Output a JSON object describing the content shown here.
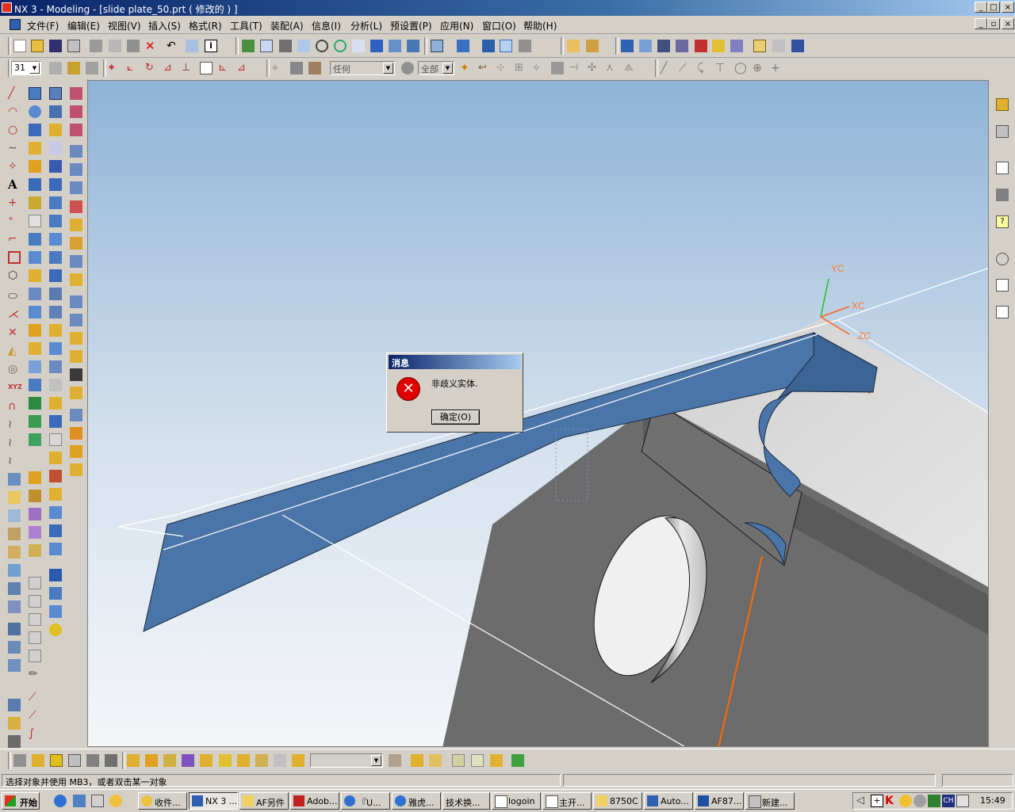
{
  "window": {
    "title": "NX 3 - Modeling - [slide plate_50.prt ( 修改的 ) ]",
    "controls": [
      "_",
      "□",
      "×"
    ]
  },
  "menu": {
    "items": [
      "文件(F)",
      "编辑(E)",
      "视图(V)",
      "插入(S)",
      "格式(R)",
      "工具(T)",
      "装配(A)",
      "信息(I)",
      "分析(L)",
      "预设置(P)",
      "应用(N)",
      "窗口(O)",
      "帮助(H)"
    ]
  },
  "toolbar2": {
    "layer_value": "31",
    "type_filter": "任何",
    "scope_filter": "全部"
  },
  "viewport": {
    "axis_labels": {
      "yc": "YC",
      "xc": "XC",
      "zc": "ZC"
    },
    "colors": {
      "bg_top": "#8fb3d6",
      "bg_bottom": "#eef2f6",
      "solid": "#6d6d6d",
      "sheet": "#4a75a8",
      "edge": "#ff6a00"
    }
  },
  "dialog": {
    "title": "消息",
    "message": "非歧义实体.",
    "ok_label": "确定(O)",
    "icon": "error-icon"
  },
  "status": {
    "prompt": "选择对象并使用 MB3，或者双击某一对象"
  },
  "taskbar": {
    "start_label": "开始",
    "tasks": [
      "收件...",
      "NX 3 ...",
      "AF另件",
      "Adob...",
      "『U...",
      "雅虎...",
      "技术换...",
      "logoin",
      "主开...",
      "8750C",
      "Auto...",
      "AF87...",
      "新建..."
    ],
    "clock": "15:49",
    "ime": "CH"
  }
}
